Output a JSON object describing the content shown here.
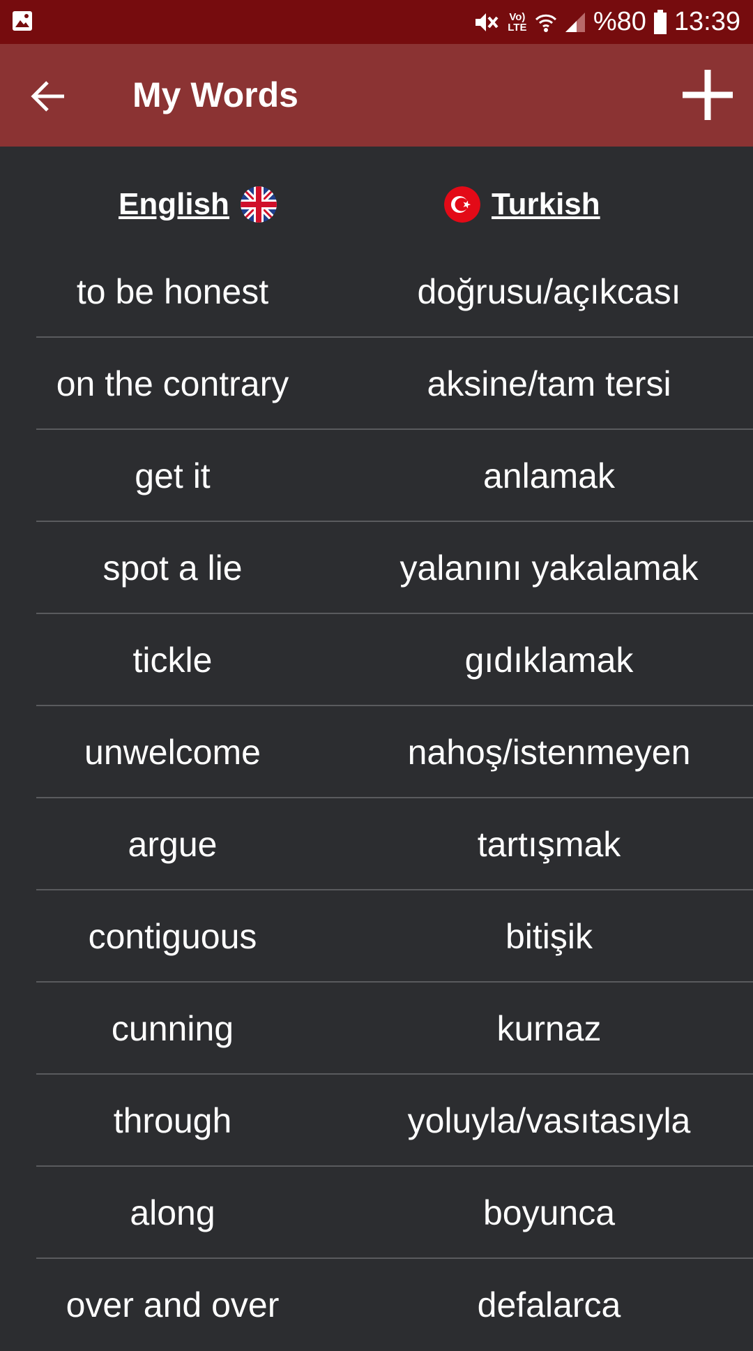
{
  "status_bar": {
    "battery_text": "%80",
    "time": "13:39",
    "network_label": "Vo) LTE",
    "icons": [
      "gallery-icon",
      "mute-icon",
      "volte-icon",
      "wifi-icon",
      "signal-icon",
      "battery-icon"
    ]
  },
  "app_bar": {
    "title": "My Words",
    "back_icon": "arrow-left-icon",
    "add_icon": "plus-icon",
    "color": "#8b3333"
  },
  "columns": {
    "source": {
      "label": "English",
      "flag": "uk-flag-icon"
    },
    "target": {
      "label": "Turkish",
      "flag": "turkey-flag-icon"
    }
  },
  "words": [
    {
      "en": "to be honest",
      "tr": "doğrusu/açıkcası"
    },
    {
      "en": "on the contrary",
      "tr": "aksine/tam tersi"
    },
    {
      "en": "get it",
      "tr": "anlamak"
    },
    {
      "en": "spot a lie",
      "tr": "yalanını yakalamak"
    },
    {
      "en": "tickle",
      "tr": "gıdıklamak"
    },
    {
      "en": "unwelcome",
      "tr": "nahoş/istenmeyen"
    },
    {
      "en": "argue",
      "tr": "tartışmak"
    },
    {
      "en": "contiguous",
      "tr": "bitişik"
    },
    {
      "en": "cunning",
      "tr": "kurnaz"
    },
    {
      "en": "through",
      "tr": "yoluyla/vasıtasıyla"
    },
    {
      "en": "along",
      "tr": "boyunca"
    },
    {
      "en": "over and over",
      "tr": "defalarca"
    }
  ]
}
